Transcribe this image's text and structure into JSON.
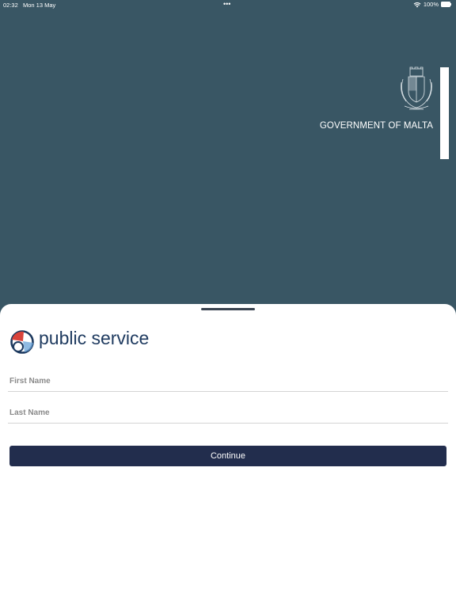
{
  "status_bar": {
    "time": "02:32",
    "date": "Mon 13 May",
    "dots": "•••",
    "battery": "100%",
    "icons": [
      "wifi-icon",
      "battery-icon"
    ]
  },
  "header": {
    "government_label": "GOVERNMENT OF MALTA",
    "emblem": "coat-of-arms-icon"
  },
  "sheet": {
    "brand": {
      "title": "public service",
      "logo": "public-service-logo-icon"
    },
    "form": {
      "first_name_placeholder": "First Name",
      "first_name_value": "",
      "last_name_placeholder": "Last Name",
      "last_name_value": "",
      "continue_label": "Continue"
    }
  },
  "colors": {
    "background": "#395664",
    "sheet": "#ffffff",
    "button": "#222d4d",
    "brand_text": "#1e3a5f",
    "logo_red": "#d9433b",
    "logo_navy": "#1e3a5f",
    "logo_blue": "#6aa3d8"
  }
}
